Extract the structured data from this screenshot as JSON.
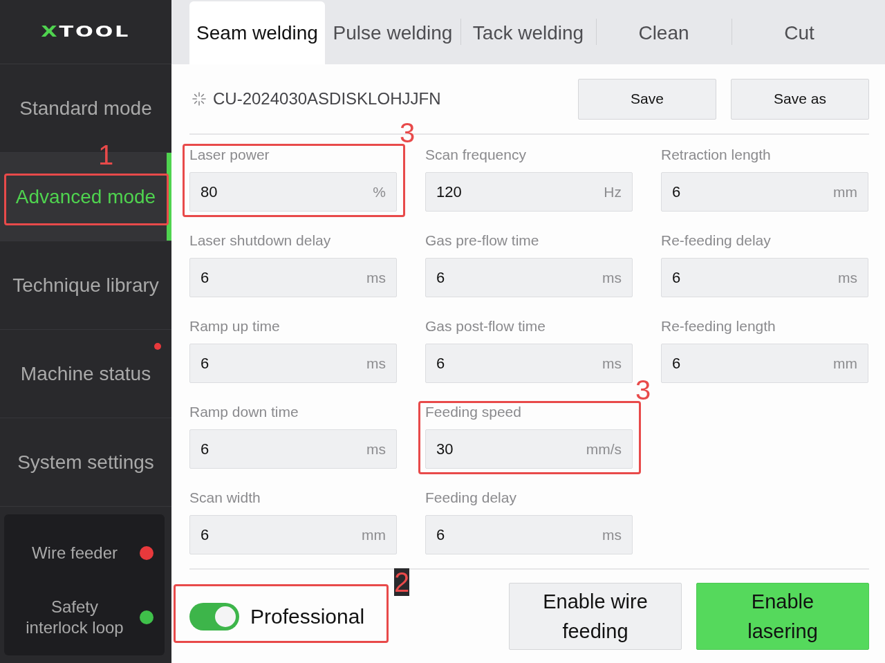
{
  "sidebar": {
    "logo": {
      "accent": "X",
      "name": "TOOL"
    },
    "items": [
      {
        "label": "Standard mode",
        "selected": false,
        "notify": false
      },
      {
        "label": "Advanced mode",
        "selected": true,
        "notify": false,
        "callout": {
          "number": "1"
        }
      },
      {
        "label": "Technique library",
        "selected": false,
        "notify": false
      },
      {
        "label": "Machine status",
        "selected": false,
        "notify": true
      },
      {
        "label": "System settings",
        "selected": false,
        "notify": false
      }
    ],
    "status_panel": {
      "items": [
        {
          "label": "Wire feeder",
          "color": "#e8393c"
        },
        {
          "label": "Safety interlock loop",
          "color": "#3fc04a"
        }
      ]
    }
  },
  "tabs": [
    {
      "label": "Seam welding",
      "selected": true
    },
    {
      "label": "Pulse welding",
      "selected": false
    },
    {
      "label": "Tack welding",
      "selected": false
    },
    {
      "label": "Clean",
      "selected": false
    },
    {
      "label": "Cut",
      "selected": false
    }
  ],
  "preset": {
    "code": "CU-2024030ASDISKLOHJJFN",
    "buttons": [
      "Save",
      "Save as"
    ]
  },
  "fields": {
    "columns": [
      [
        {
          "label": "Laser power",
          "value": "80",
          "unit": "%",
          "callout": {
            "number": "3"
          }
        },
        {
          "label": "Laser shutdown delay",
          "value": "6",
          "unit": "ms"
        },
        {
          "label": "Ramp up time",
          "value": "6",
          "unit": "ms"
        },
        {
          "label": "Ramp down time",
          "value": "6",
          "unit": "ms"
        },
        {
          "label": "Scan width",
          "value": "6",
          "unit": "mm"
        }
      ],
      [
        {
          "label": "Scan frequency",
          "value": "120",
          "unit": "Hz"
        },
        {
          "label": "Gas pre-flow time",
          "value": "6",
          "unit": "ms"
        },
        {
          "label": "Gas post-flow time",
          "value": "6",
          "unit": "ms"
        },
        {
          "label": "Feeding speed",
          "value": "30",
          "unit": "mm/s",
          "callout": {
            "number": "3"
          }
        },
        {
          "label": "Feeding delay",
          "value": "6",
          "unit": "ms"
        }
      ],
      [
        {
          "label": "Retraction length",
          "value": "6",
          "unit": "mm"
        },
        {
          "label": "Re-feeding delay",
          "value": "6",
          "unit": "ms"
        },
        {
          "label": "Re-feeding length",
          "value": "6",
          "unit": "mm"
        }
      ]
    ]
  },
  "professional_toggle": {
    "label": "Professional",
    "on": true,
    "callout": {
      "number": "2"
    }
  },
  "actions": [
    {
      "label": "Enable wire feeding",
      "kind": "secondary"
    },
    {
      "label": "Enable lasering",
      "kind": "primary"
    }
  ]
}
